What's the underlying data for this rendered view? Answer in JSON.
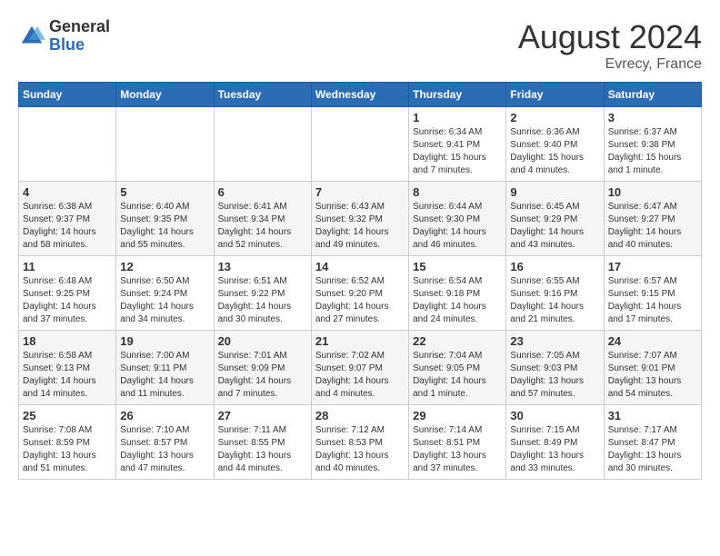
{
  "header": {
    "logo_general": "General",
    "logo_blue": "Blue",
    "month_year": "August 2024",
    "location": "Evrecy, France"
  },
  "days_of_week": [
    "Sunday",
    "Monday",
    "Tuesday",
    "Wednesday",
    "Thursday",
    "Friday",
    "Saturday"
  ],
  "weeks": [
    [
      {
        "day": "",
        "content": ""
      },
      {
        "day": "",
        "content": ""
      },
      {
        "day": "",
        "content": ""
      },
      {
        "day": "",
        "content": ""
      },
      {
        "day": "1",
        "content": "Sunrise: 6:34 AM\nSunset: 9:41 PM\nDaylight: 15 hours and 7 minutes."
      },
      {
        "day": "2",
        "content": "Sunrise: 6:36 AM\nSunset: 9:40 PM\nDaylight: 15 hours and 4 minutes."
      },
      {
        "day": "3",
        "content": "Sunrise: 6:37 AM\nSunset: 9:38 PM\nDaylight: 15 hours and 1 minute."
      }
    ],
    [
      {
        "day": "4",
        "content": "Sunrise: 6:38 AM\nSunset: 9:37 PM\nDaylight: 14 hours and 58 minutes."
      },
      {
        "day": "5",
        "content": "Sunrise: 6:40 AM\nSunset: 9:35 PM\nDaylight: 14 hours and 55 minutes."
      },
      {
        "day": "6",
        "content": "Sunrise: 6:41 AM\nSunset: 9:34 PM\nDaylight: 14 hours and 52 minutes."
      },
      {
        "day": "7",
        "content": "Sunrise: 6:43 AM\nSunset: 9:32 PM\nDaylight: 14 hours and 49 minutes."
      },
      {
        "day": "8",
        "content": "Sunrise: 6:44 AM\nSunset: 9:30 PM\nDaylight: 14 hours and 46 minutes."
      },
      {
        "day": "9",
        "content": "Sunrise: 6:45 AM\nSunset: 9:29 PM\nDaylight: 14 hours and 43 minutes."
      },
      {
        "day": "10",
        "content": "Sunrise: 6:47 AM\nSunset: 9:27 PM\nDaylight: 14 hours and 40 minutes."
      }
    ],
    [
      {
        "day": "11",
        "content": "Sunrise: 6:48 AM\nSunset: 9:25 PM\nDaylight: 14 hours and 37 minutes."
      },
      {
        "day": "12",
        "content": "Sunrise: 6:50 AM\nSunset: 9:24 PM\nDaylight: 14 hours and 34 minutes."
      },
      {
        "day": "13",
        "content": "Sunrise: 6:51 AM\nSunset: 9:22 PM\nDaylight: 14 hours and 30 minutes."
      },
      {
        "day": "14",
        "content": "Sunrise: 6:52 AM\nSunset: 9:20 PM\nDaylight: 14 hours and 27 minutes."
      },
      {
        "day": "15",
        "content": "Sunrise: 6:54 AM\nSunset: 9:18 PM\nDaylight: 14 hours and 24 minutes."
      },
      {
        "day": "16",
        "content": "Sunrise: 6:55 AM\nSunset: 9:16 PM\nDaylight: 14 hours and 21 minutes."
      },
      {
        "day": "17",
        "content": "Sunrise: 6:57 AM\nSunset: 9:15 PM\nDaylight: 14 hours and 17 minutes."
      }
    ],
    [
      {
        "day": "18",
        "content": "Sunrise: 6:58 AM\nSunset: 9:13 PM\nDaylight: 14 hours and 14 minutes."
      },
      {
        "day": "19",
        "content": "Sunrise: 7:00 AM\nSunset: 9:11 PM\nDaylight: 14 hours and 11 minutes."
      },
      {
        "day": "20",
        "content": "Sunrise: 7:01 AM\nSunset: 9:09 PM\nDaylight: 14 hours and 7 minutes."
      },
      {
        "day": "21",
        "content": "Sunrise: 7:02 AM\nSunset: 9:07 PM\nDaylight: 14 hours and 4 minutes."
      },
      {
        "day": "22",
        "content": "Sunrise: 7:04 AM\nSunset: 9:05 PM\nDaylight: 14 hours and 1 minute."
      },
      {
        "day": "23",
        "content": "Sunrise: 7:05 AM\nSunset: 9:03 PM\nDaylight: 13 hours and 57 minutes."
      },
      {
        "day": "24",
        "content": "Sunrise: 7:07 AM\nSunset: 9:01 PM\nDaylight: 13 hours and 54 minutes."
      }
    ],
    [
      {
        "day": "25",
        "content": "Sunrise: 7:08 AM\nSunset: 8:59 PM\nDaylight: 13 hours and 51 minutes."
      },
      {
        "day": "26",
        "content": "Sunrise: 7:10 AM\nSunset: 8:57 PM\nDaylight: 13 hours and 47 minutes."
      },
      {
        "day": "27",
        "content": "Sunrise: 7:11 AM\nSunset: 8:55 PM\nDaylight: 13 hours and 44 minutes."
      },
      {
        "day": "28",
        "content": "Sunrise: 7:12 AM\nSunset: 8:53 PM\nDaylight: 13 hours and 40 minutes."
      },
      {
        "day": "29",
        "content": "Sunrise: 7:14 AM\nSunset: 8:51 PM\nDaylight: 13 hours and 37 minutes."
      },
      {
        "day": "30",
        "content": "Sunrise: 7:15 AM\nSunset: 8:49 PM\nDaylight: 13 hours and 33 minutes."
      },
      {
        "day": "31",
        "content": "Sunrise: 7:17 AM\nSunset: 8:47 PM\nDaylight: 13 hours and 30 minutes."
      }
    ]
  ]
}
